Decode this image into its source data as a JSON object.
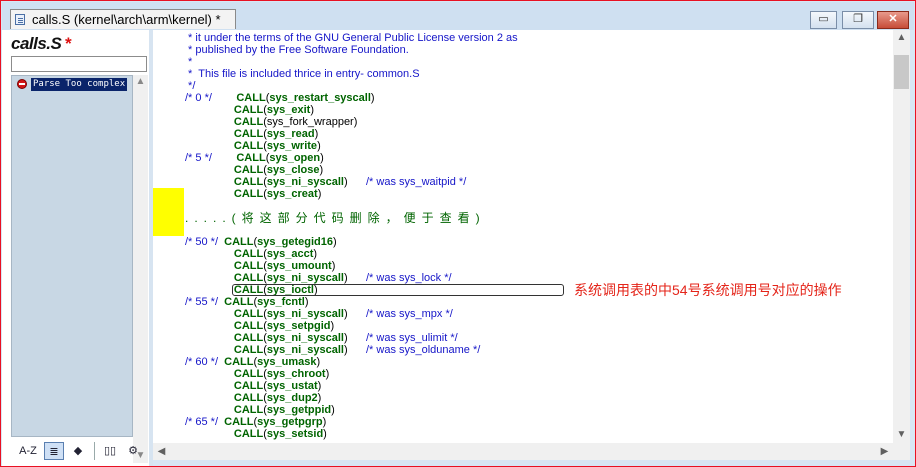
{
  "window": {
    "tab_title": "calls.S (kernel\\arch\\arm\\kernel) *",
    "buttons": {
      "minimize": "▭",
      "restore": "❐",
      "close": "✕"
    }
  },
  "left_panel": {
    "file_name": "calls.S",
    "modified_marker": "*",
    "search_value": "",
    "symbol_items": [
      {
        "label": "Parse Too complex",
        "icon": "error-icon"
      }
    ],
    "toolbar": [
      {
        "label": "A-Z",
        "icon": "sort-az-icon"
      },
      {
        "label": "≣",
        "icon": "list-view-icon"
      },
      {
        "label": "◆",
        "icon": "symbol-types-icon"
      },
      {
        "label": "▯▯",
        "icon": "book-icon"
      },
      {
        "label": "⚙",
        "icon": "properties-icon"
      }
    ]
  },
  "code_lines": [
    [
      {
        "t": " * it under the terms of the GNU General Public License version 2 as",
        "c": "c-cmt"
      }
    ],
    [
      {
        "t": " * published by the Free Software Foundation.",
        "c": "c-cmt"
      }
    ],
    [
      {
        "t": " *",
        "c": "c-cmt"
      }
    ],
    [
      {
        "t": " *  This file is included thrice in entry- common.S",
        "c": "c-cmt"
      }
    ],
    [
      {
        "t": " */",
        "c": "c-cmt"
      }
    ],
    [
      {
        "t": "/* 0 */",
        "c": "c-cmt"
      },
      {
        "t": "        ",
        "c": "c-plain"
      },
      {
        "t": "CALL",
        "c": "c-kw"
      },
      {
        "t": "(",
        "c": "c-plain"
      },
      {
        "t": "sys_restart_syscall",
        "c": "c-fn"
      },
      {
        "t": ")",
        "c": "c-plain"
      }
    ],
    [
      {
        "t": "                ",
        "c": "c-plain"
      },
      {
        "t": "CALL",
        "c": "c-kw"
      },
      {
        "t": "(",
        "c": "c-plain"
      },
      {
        "t": "sys_exit",
        "c": "c-fn"
      },
      {
        "t": ")",
        "c": "c-plain"
      }
    ],
    [
      {
        "t": "                ",
        "c": "c-plain"
      },
      {
        "t": "CALL",
        "c": "c-kw"
      },
      {
        "t": "(",
        "c": "c-plain"
      },
      {
        "t": "sys_fork_wrapper",
        "c": "c-plainfn"
      },
      {
        "t": ")",
        "c": "c-plain"
      }
    ],
    [
      {
        "t": "                ",
        "c": "c-plain"
      },
      {
        "t": "CALL",
        "c": "c-kw"
      },
      {
        "t": "(",
        "c": "c-plain"
      },
      {
        "t": "sys_read",
        "c": "c-fn"
      },
      {
        "t": ")",
        "c": "c-plain"
      }
    ],
    [
      {
        "t": "                ",
        "c": "c-plain"
      },
      {
        "t": "CALL",
        "c": "c-kw"
      },
      {
        "t": "(",
        "c": "c-plain"
      },
      {
        "t": "sys_write",
        "c": "c-fn"
      },
      {
        "t": ")",
        "c": "c-plain"
      }
    ],
    [
      {
        "t": "/* 5 */",
        "c": "c-cmt"
      },
      {
        "t": "        ",
        "c": "c-plain"
      },
      {
        "t": "CALL",
        "c": "c-kw"
      },
      {
        "t": "(",
        "c": "c-plain"
      },
      {
        "t": "sys_open",
        "c": "c-fn"
      },
      {
        "t": ")",
        "c": "c-plain"
      }
    ],
    [
      {
        "t": "                ",
        "c": "c-plain"
      },
      {
        "t": "CALL",
        "c": "c-kw"
      },
      {
        "t": "(",
        "c": "c-plain"
      },
      {
        "t": "sys_close",
        "c": "c-fn"
      },
      {
        "t": ")",
        "c": "c-plain"
      }
    ],
    [
      {
        "t": "                ",
        "c": "c-plain"
      },
      {
        "t": "CALL",
        "c": "c-kw"
      },
      {
        "t": "(",
        "c": "c-plain"
      },
      {
        "t": "sys_ni_syscall",
        "c": "c-fn"
      },
      {
        "t": ")      ",
        "c": "c-plain"
      },
      {
        "t": "/* was sys_waitpid */",
        "c": "c-cmt"
      }
    ],
    [
      {
        "t": "                ",
        "c": "c-plain"
      },
      {
        "t": "CALL",
        "c": "c-kw"
      },
      {
        "t": "(",
        "c": "c-plain"
      },
      {
        "t": "sys_creat",
        "c": "c-fn"
      },
      {
        "t": ")",
        "c": "c-plain"
      }
    ],
    [],
    [
      {
        "t": ".....(将这部分代码删除，便于查看)",
        "c": "omitted"
      }
    ],
    [],
    [
      {
        "t": "/* 50 */",
        "c": "c-cmt"
      },
      {
        "t": "  ",
        "c": "c-plain"
      },
      {
        "t": "CALL",
        "c": "c-kw"
      },
      {
        "t": "(",
        "c": "c-plain"
      },
      {
        "t": "sys_getegid16",
        "c": "c-fn"
      },
      {
        "t": ")",
        "c": "c-plain"
      }
    ],
    [
      {
        "t": "                ",
        "c": "c-plain"
      },
      {
        "t": "CALL",
        "c": "c-kw"
      },
      {
        "t": "(",
        "c": "c-plain"
      },
      {
        "t": "sys_acct",
        "c": "c-fn"
      },
      {
        "t": ")",
        "c": "c-plain"
      }
    ],
    [
      {
        "t": "                ",
        "c": "c-plain"
      },
      {
        "t": "CALL",
        "c": "c-kw"
      },
      {
        "t": "(",
        "c": "c-plain"
      },
      {
        "t": "sys_umount",
        "c": "c-fn"
      },
      {
        "t": ")",
        "c": "c-plain"
      }
    ],
    [
      {
        "t": "                ",
        "c": "c-plain"
      },
      {
        "t": "CALL",
        "c": "c-kw"
      },
      {
        "t": "(",
        "c": "c-plain"
      },
      {
        "t": "sys_ni_syscall",
        "c": "c-fn"
      },
      {
        "t": ")      ",
        "c": "c-plain"
      },
      {
        "t": "/* was sys_lock */",
        "c": "c-cmt"
      }
    ],
    [
      {
        "t": "                ",
        "c": "c-plain"
      },
      {
        "t": "CALL",
        "c": "c-kw"
      },
      {
        "t": "(",
        "c": "c-plain"
      },
      {
        "t": "sys_ioctl",
        "c": "c-fn"
      },
      {
        "t": ")",
        "c": "c-plain"
      }
    ],
    [
      {
        "t": "/* 55 */",
        "c": "c-cmt"
      },
      {
        "t": "  ",
        "c": "c-plain"
      },
      {
        "t": "CALL",
        "c": "c-kw"
      },
      {
        "t": "(",
        "c": "c-plain"
      },
      {
        "t": "sys_fcntl",
        "c": "c-fn"
      },
      {
        "t": ")",
        "c": "c-plain"
      }
    ],
    [
      {
        "t": "                ",
        "c": "c-plain"
      },
      {
        "t": "CALL",
        "c": "c-kw"
      },
      {
        "t": "(",
        "c": "c-plain"
      },
      {
        "t": "sys_ni_syscall",
        "c": "c-fn"
      },
      {
        "t": ")      ",
        "c": "c-plain"
      },
      {
        "t": "/* was sys_mpx */",
        "c": "c-cmt"
      }
    ],
    [
      {
        "t": "                ",
        "c": "c-plain"
      },
      {
        "t": "CALL",
        "c": "c-kw"
      },
      {
        "t": "(",
        "c": "c-plain"
      },
      {
        "t": "sys_setpgid",
        "c": "c-fn"
      },
      {
        "t": ")",
        "c": "c-plain"
      }
    ],
    [
      {
        "t": "                ",
        "c": "c-plain"
      },
      {
        "t": "CALL",
        "c": "c-kw"
      },
      {
        "t": "(",
        "c": "c-plain"
      },
      {
        "t": "sys_ni_syscall",
        "c": "c-fn"
      },
      {
        "t": ")      ",
        "c": "c-plain"
      },
      {
        "t": "/* was sys_ulimit */",
        "c": "c-cmt"
      }
    ],
    [
      {
        "t": "                ",
        "c": "c-plain"
      },
      {
        "t": "CALL",
        "c": "c-kw"
      },
      {
        "t": "(",
        "c": "c-plain"
      },
      {
        "t": "sys_ni_syscall",
        "c": "c-fn"
      },
      {
        "t": ")      ",
        "c": "c-plain"
      },
      {
        "t": "/* was sys_olduname */",
        "c": "c-cmt"
      }
    ],
    [
      {
        "t": "/* 60 */",
        "c": "c-cmt"
      },
      {
        "t": "  ",
        "c": "c-plain"
      },
      {
        "t": "CALL",
        "c": "c-kw"
      },
      {
        "t": "(",
        "c": "c-plain"
      },
      {
        "t": "sys_umask",
        "c": "c-fn"
      },
      {
        "t": ")",
        "c": "c-plain"
      }
    ],
    [
      {
        "t": "                ",
        "c": "c-plain"
      },
      {
        "t": "CALL",
        "c": "c-kw"
      },
      {
        "t": "(",
        "c": "c-plain"
      },
      {
        "t": "sys_chroot",
        "c": "c-fn"
      },
      {
        "t": ")",
        "c": "c-plain"
      }
    ],
    [
      {
        "t": "                ",
        "c": "c-plain"
      },
      {
        "t": "CALL",
        "c": "c-kw"
      },
      {
        "t": "(",
        "c": "c-plain"
      },
      {
        "t": "sys_ustat",
        "c": "c-fn"
      },
      {
        "t": ")",
        "c": "c-plain"
      }
    ],
    [
      {
        "t": "                ",
        "c": "c-plain"
      },
      {
        "t": "CALL",
        "c": "c-kw"
      },
      {
        "t": "(",
        "c": "c-plain"
      },
      {
        "t": "sys_dup2",
        "c": "c-fn"
      },
      {
        "t": ")",
        "c": "c-plain"
      }
    ],
    [
      {
        "t": "                ",
        "c": "c-plain"
      },
      {
        "t": "CALL",
        "c": "c-kw"
      },
      {
        "t": "(",
        "c": "c-plain"
      },
      {
        "t": "sys_getppid",
        "c": "c-fn"
      },
      {
        "t": ")",
        "c": "c-plain"
      }
    ],
    [
      {
        "t": "/* 65 */",
        "c": "c-cmt"
      },
      {
        "t": "  ",
        "c": "c-plain"
      },
      {
        "t": "CALL",
        "c": "c-kw"
      },
      {
        "t": "(",
        "c": "c-plain"
      },
      {
        "t": "sys_getpgrp",
        "c": "c-fn"
      },
      {
        "t": ")",
        "c": "c-plain"
      }
    ],
    [
      {
        "t": "                ",
        "c": "c-plain"
      },
      {
        "t": "CALL",
        "c": "c-kw"
      },
      {
        "t": "(",
        "c": "c-plain"
      },
      {
        "t": "sys_setsid",
        "c": "c-fn"
      },
      {
        "t": ")",
        "c": "c-plain"
      }
    ]
  ],
  "annotation": {
    "text": "系统调用表的中54号系统调用号对应的操作",
    "color": "#e4251a"
  },
  "colors": {
    "comment": "#1515c8",
    "keyword": "#006400",
    "highlight": "#ffff00",
    "frame_border": "#e81123"
  }
}
